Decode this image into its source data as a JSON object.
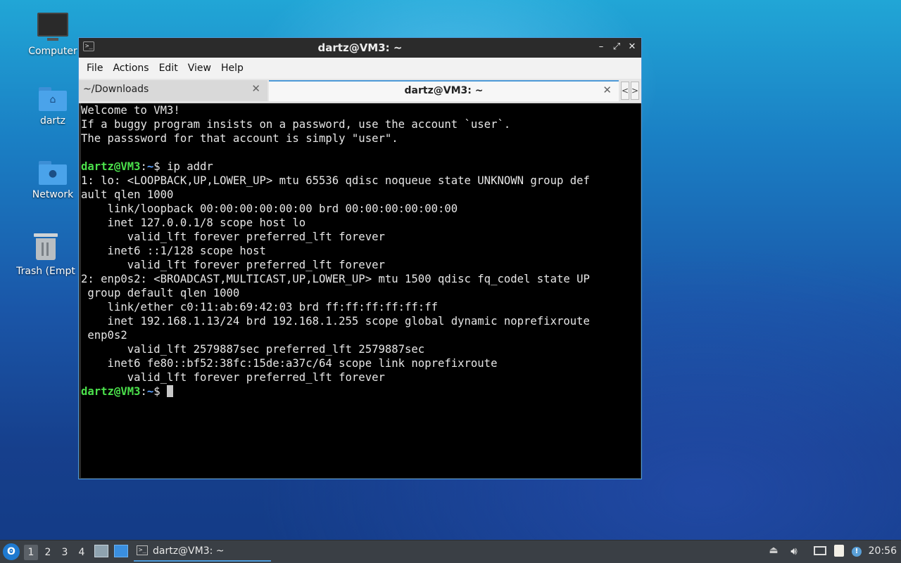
{
  "desktop": {
    "icons": [
      {
        "label": "Computer",
        "icon": "monitor-icon"
      },
      {
        "label": "dartz",
        "icon": "home-folder-icon"
      },
      {
        "label": "Network",
        "icon": "network-folder-icon"
      },
      {
        "label": "Trash (Empt",
        "icon": "trash-icon"
      }
    ]
  },
  "window": {
    "title": "dartz@VM3: ~",
    "controls": {
      "minimize": "–",
      "maximize": "⤢",
      "close": "✕"
    },
    "menu": [
      "File",
      "Actions",
      "Edit",
      "View",
      "Help"
    ],
    "tabs": [
      {
        "label": "~/Downloads",
        "close": "✕"
      },
      {
        "label": "dartz@VM3: ~",
        "close": "✕"
      }
    ],
    "tab_scroll": {
      "left": "<",
      "right": ">"
    }
  },
  "terminal": {
    "welcome": [
      "Welcome to VM3!",
      "If a buggy program insists on a password, use the account `user`.",
      "The passsword for that account is simply \"user\"."
    ],
    "prompt_user": "dartz@VM3",
    "prompt_sep": ":",
    "prompt_path": "~",
    "prompt_symbol": "$ ",
    "command": "ip addr",
    "output": [
      "1: lo: <LOOPBACK,UP,LOWER_UP> mtu 65536 qdisc noqueue state UNKNOWN group def",
      "ault qlen 1000",
      "    link/loopback 00:00:00:00:00:00 brd 00:00:00:00:00:00",
      "    inet 127.0.0.1/8 scope host lo",
      "       valid_lft forever preferred_lft forever",
      "    inet6 ::1/128 scope host",
      "       valid_lft forever preferred_lft forever",
      "2: enp0s2: <BROADCAST,MULTICAST,UP,LOWER_UP> mtu 1500 qdisc fq_codel state UP",
      " group default qlen 1000",
      "    link/ether c0:11:ab:69:42:03 brd ff:ff:ff:ff:ff:ff",
      "    inet 192.168.1.13/24 brd 192.168.1.255 scope global dynamic noprefixroute",
      " enp0s2",
      "       valid_lft 2579887sec preferred_lft 2579887sec",
      "    inet6 fe80::bf52:38fc:15de:a37c/64 scope link noprefixroute",
      "       valid_lft forever preferred_lft forever"
    ]
  },
  "taskbar": {
    "start_icon": "lubuntu-start-icon",
    "workspaces": [
      "1",
      "2",
      "3",
      "4"
    ],
    "active_workspace": "1",
    "quicklaunch": [
      "file-manager-icon",
      "show-desktop-icon"
    ],
    "task": {
      "label": "dartz@VM3: ~",
      "icon": "terminal-icon"
    },
    "tray": [
      "eject-icon",
      "volume-icon",
      "network-icon",
      "clipboard-icon",
      "notification-icon"
    ],
    "clock": "20:56"
  }
}
